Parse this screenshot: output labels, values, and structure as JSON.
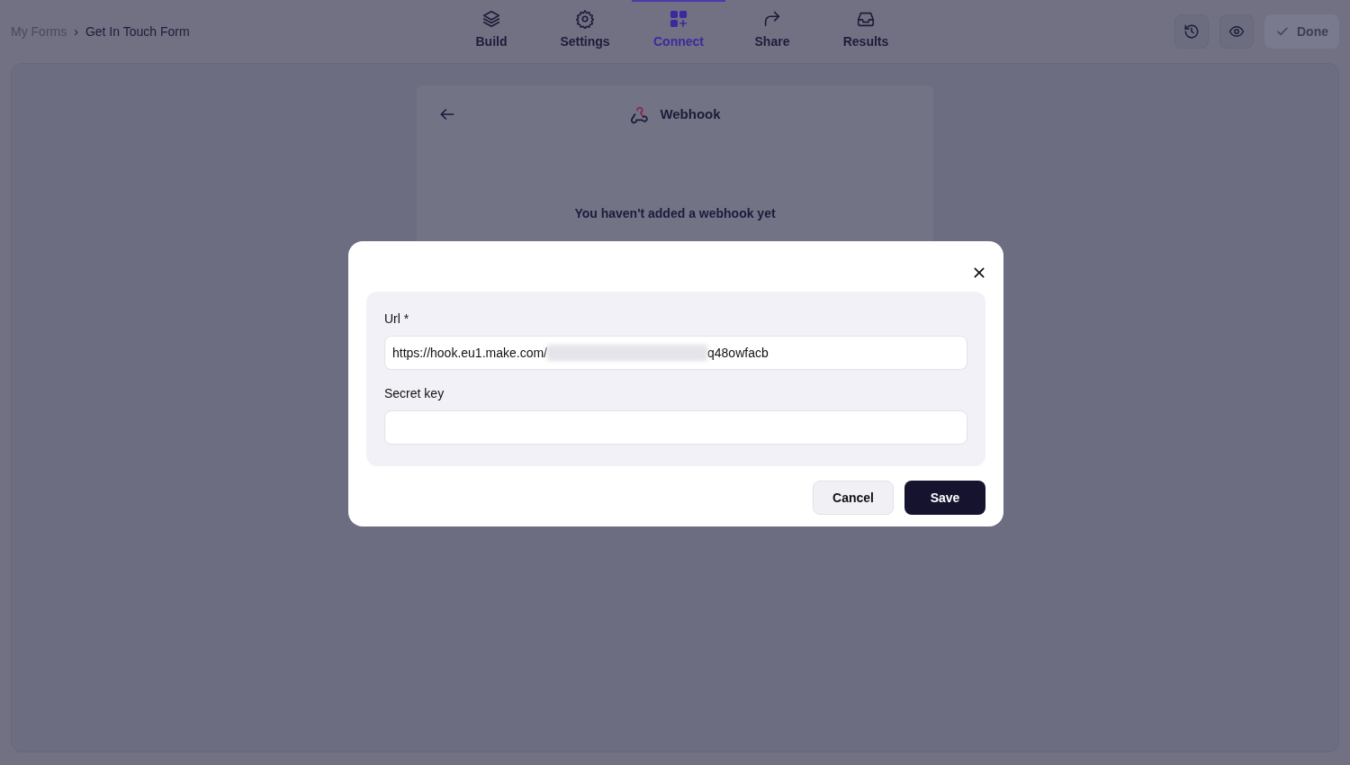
{
  "breadcrumb": [
    {
      "label": "My Forms",
      "current": false
    },
    {
      "label": "Get In Touch Form",
      "current": true
    }
  ],
  "breadcrumb_separator": "›",
  "tabs": [
    {
      "label": "Build",
      "selected": false
    },
    {
      "label": "Settings",
      "selected": false
    },
    {
      "label": "Connect",
      "selected": true
    },
    {
      "label": "Share",
      "selected": false
    },
    {
      "label": "Results",
      "selected": false
    }
  ],
  "toolbar": {
    "done_label": "Done",
    "done_disabled": true
  },
  "panel": {
    "title": "Webhook",
    "empty_message": "You haven't added a webhook yet"
  },
  "dialog": {
    "fields": [
      {
        "label": "Url *",
        "value_start": "https://hook.eu1.make.com/",
        "redacted": true,
        "value_end": "q48owfacb"
      },
      {
        "label": "Secret key"
      }
    ],
    "buttons": [
      {
        "label": "Cancel",
        "kind": "secondary"
      },
      {
        "label": "Save",
        "kind": "primary"
      }
    ]
  }
}
